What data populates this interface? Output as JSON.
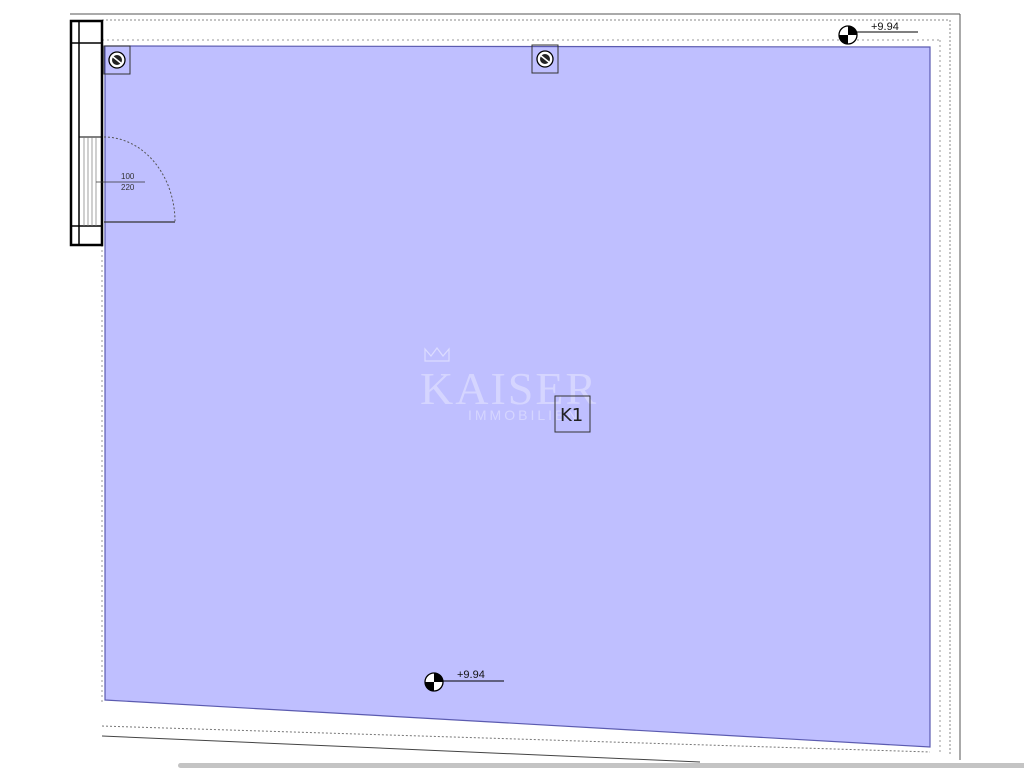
{
  "door": {
    "width_label": "100",
    "height_label": "220"
  },
  "levels": {
    "top_right": "+9.94",
    "bottom": "+9.94"
  },
  "room": {
    "label": "K1",
    "fill_color": "#bfbfff",
    "outline_color": "#5b5bb0"
  },
  "watermark": {
    "brand": "KAISER",
    "sub": "IMMOBILIEN"
  },
  "icons": {
    "crown": "crown-icon",
    "duct": "duct-icon",
    "level_marker": "level-marker-icon"
  }
}
